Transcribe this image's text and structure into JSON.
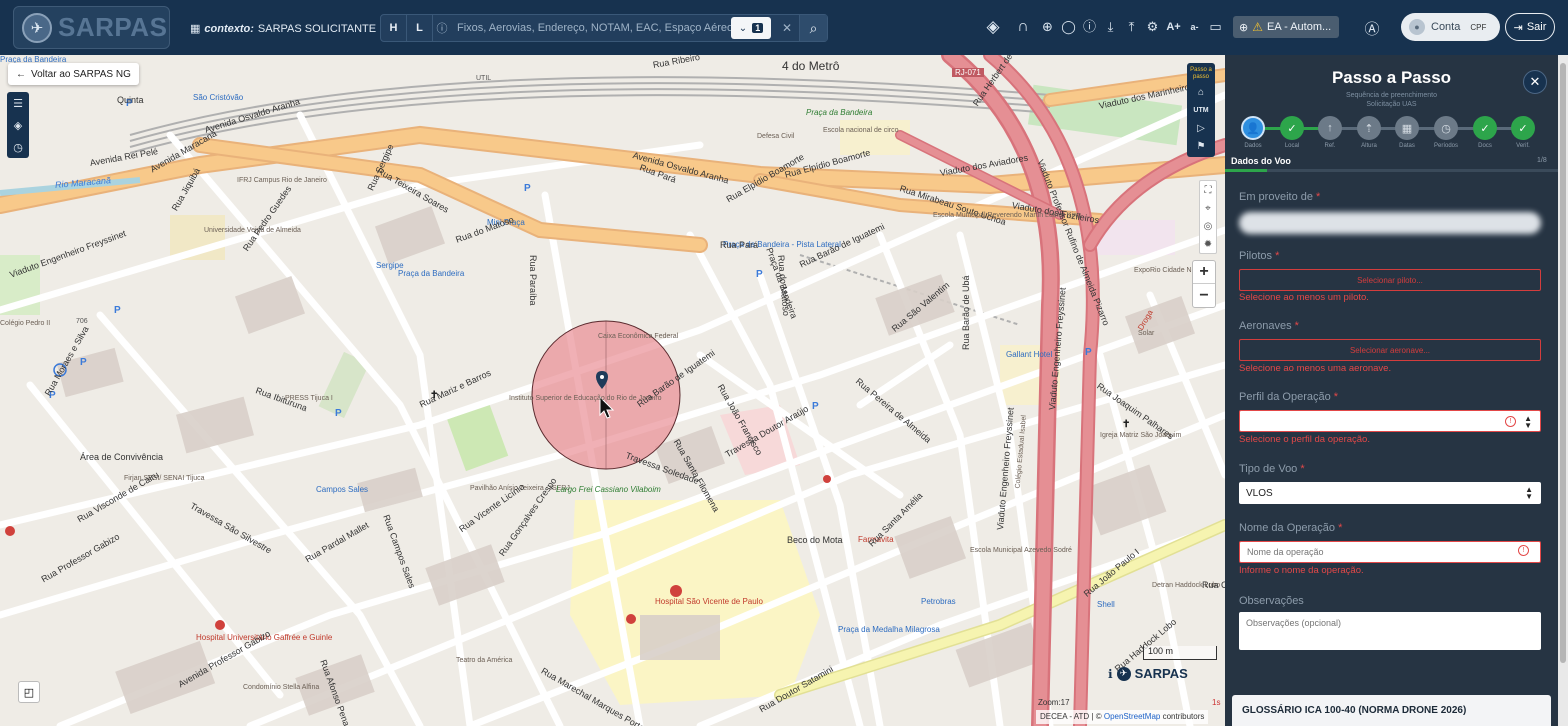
{
  "header": {
    "logo_text": "SARPAS",
    "context_label": "contexto:",
    "context_value": "SARPAS SOLICITANTE",
    "search": {
      "h_label": "H",
      "l_label": "L",
      "placeholder": "Fixos, Aerovias, Endereço, NOTAM, EAC, Espaço Aéreo (",
      "filter_count": "1"
    },
    "env_label": "EA - Autom...",
    "account_label": "Conta",
    "account_cpf": "CPF",
    "logout_label": "Sair"
  },
  "map": {
    "back_label": "Voltar ao SARPAS NG",
    "passo_label": "Passo a passo",
    "utm_label": "UTM",
    "zoom_in": "+",
    "zoom_out": "−",
    "scale_label": "100 m",
    "zoom_label": "Zoom:17",
    "attribution_prefix": "DECEA - ATD | ©",
    "attribution_link": "OpenStreetMap",
    "attribution_suffix": "contributors",
    "brand": "SARPAS",
    "timestamp": "1s",
    "labels": [
      {
        "text": "4 do Metrô",
        "cls": "lbl-lg"
      },
      {
        "text": "São Cristóvão",
        "cls": "lbl-blue"
      },
      {
        "text": "Quinta",
        "cls": "lbl"
      },
      {
        "text": "UTIL",
        "cls": "lbl-sm"
      },
      {
        "text": "Rua Ribeiro",
        "cls": "lbl"
      },
      {
        "text": "Avenida Osvaldo Aranha",
        "cls": "lbl"
      },
      {
        "text": "Avenida Rei Pelé",
        "cls": "lbl"
      },
      {
        "text": "Rio Maracanã",
        "cls": "lbl-water"
      },
      {
        "text": "Avenida Maracanã",
        "cls": "lbl"
      },
      {
        "text": "Rua Teixeira Soares",
        "cls": "lbl"
      },
      {
        "text": "Avenida Osvaldo Aranha",
        "cls": "lbl"
      },
      {
        "text": "Rua Pará",
        "cls": "lbl"
      },
      {
        "text": "Rua Elpídio Boamorte",
        "cls": "lbl"
      },
      {
        "text": "Praça da Bandeira",
        "cls": "lbl-green"
      },
      {
        "text": "Escola nacional de circo",
        "cls": "lbl-gray"
      },
      {
        "text": "Defesa Civil",
        "cls": "lbl-gray"
      },
      {
        "text": "Viaduto dos Marinheiros",
        "cls": "lbl"
      },
      {
        "text": "Viaduto dos Aviadores",
        "cls": "lbl"
      },
      {
        "text": "Rua Mirabeau Souto Uchoa",
        "cls": "lbl"
      },
      {
        "text": "Viaduto dos Fuzileiros",
        "cls": "lbl"
      },
      {
        "text": "RJ-071",
        "cls": "lbl-shield"
      },
      {
        "text": "IFRJ Campus Rio de Janeiro",
        "cls": "lbl-gray"
      },
      {
        "text": "Universidade Veiga de Almeida",
        "cls": "lbl-gray"
      },
      {
        "text": "Mini Praça",
        "cls": "lbl-blue"
      },
      {
        "text": "Praça da Bandeira - Pista Lateral",
        "cls": "lbl-blue"
      },
      {
        "text": "Rua Barão de Iguatemi",
        "cls": "lbl"
      },
      {
        "text": "Escola Municipal Reverendo Martin Luther King",
        "cls": "lbl-gray"
      },
      {
        "text": "ExpoRio Cidade Nova",
        "cls": "lbl-gray"
      },
      {
        "text": "Solar",
        "cls": "lbl-gray"
      },
      {
        "text": "Gallant Hotel",
        "cls": "lbl-blue"
      },
      {
        "text": "Rua São Valentim",
        "cls": "lbl"
      },
      {
        "text": "Rua Pereira de Almeida",
        "cls": "lbl"
      },
      {
        "text": "Rua Joaquim Palhares",
        "cls": "lbl"
      },
      {
        "text": "Igreja Matriz São Joaquim",
        "cls": "lbl-gray"
      },
      {
        "text": "Caixa Econômica Federal",
        "cls": "lbl-gray"
      },
      {
        "text": "Instituto Superior de Educação do Rio de Janeiro",
        "cls": "lbl-gray"
      },
      {
        "text": "Rua Mariz e Barros",
        "cls": "lbl"
      },
      {
        "text": "Rua Barão de Iguatemi",
        "cls": "lbl"
      },
      {
        "text": "Rua João Francisco",
        "cls": "lbl"
      },
      {
        "text": "Travessa Soledade",
        "cls": "lbl"
      },
      {
        "text": "Rua Santa Filomena",
        "cls": "lbl"
      },
      {
        "text": "Travessa Doutor Araújo",
        "cls": "lbl"
      },
      {
        "text": "Rua do Matoso",
        "cls": "lbl"
      },
      {
        "text": "Beco do Mota",
        "cls": "lbl"
      },
      {
        "text": "Farmavita",
        "cls": "lbl-red"
      },
      {
        "text": "Área de Convivência",
        "cls": "lbl"
      },
      {
        "text": "Firjan SESI/ SENAI Tijuca",
        "cls": "lbl-gray"
      },
      {
        "text": "Travessa São Silvestre",
        "cls": "lbl"
      },
      {
        "text": "Campos Sales",
        "cls": "lbl-blue"
      },
      {
        "text": "Pavilhão Anísio Teixeira - ISERJ",
        "cls": "lbl-gray"
      },
      {
        "text": "Largo Frei Cassiano Vilaboim",
        "cls": "lbl-green"
      },
      {
        "text": "Hospital São Vicente de Paulo",
        "cls": "lbl-red"
      },
      {
        "text": "Hospital Universitário Gaffrée e Guinle",
        "cls": "lbl-red"
      },
      {
        "text": "Teatro da América",
        "cls": "lbl-gray"
      },
      {
        "text": "Condomínio Stella Alfina",
        "cls": "lbl-gray"
      },
      {
        "text": "Rua Marechal Marques Porto",
        "cls": "lbl"
      },
      {
        "text": "Rua Vicente Licínio",
        "cls": "lbl"
      },
      {
        "text": "Rua Gonçalves Crespo",
        "cls": "lbl"
      },
      {
        "text": "Rua Pardal Mallet",
        "cls": "lbl"
      },
      {
        "text": "Rua Campos Sales",
        "cls": "lbl"
      },
      {
        "text": "Rua Afonso Pena",
        "cls": "lbl"
      },
      {
        "text": "Rua Professor Gabizo",
        "cls": "lbl"
      },
      {
        "text": "Avenida Professor Gabizo",
        "cls": "lbl"
      },
      {
        "text": "Rua Visconde de Cairu",
        "cls": "lbl"
      },
      {
        "text": "Rua Ibituruna",
        "cls": "lbl"
      },
      {
        "text": "Rua Pedro Guedes",
        "cls": "lbl"
      },
      {
        "text": "Rua Moraes e Silva",
        "cls": "lbl"
      },
      {
        "text": "Rua Sergipe",
        "cls": "lbl"
      },
      {
        "text": "Rua Jiquibá",
        "cls": "lbl"
      },
      {
        "text": "Rua Paraíba",
        "cls": "lbl"
      },
      {
        "text": "Petrobras",
        "cls": "lbl-blue"
      },
      {
        "text": "Praça da Medalha Milagrosa",
        "cls": "lbl-blue"
      },
      {
        "text": "Escola Municipal Azevedo Sodré",
        "cls": "lbl-gray"
      },
      {
        "text": "Rua Santa Amélia",
        "cls": "lbl"
      },
      {
        "text": "Rua João Paulo I",
        "cls": "lbl"
      },
      {
        "text": "Detran Haddock Lobo",
        "cls": "lbl-gray"
      },
      {
        "text": "Shell",
        "cls": "lbl-blue"
      },
      {
        "text": "Rua Haddock Lobo",
        "cls": "lbl"
      },
      {
        "text": "Rua Doutor Satamini",
        "cls": "lbl"
      },
      {
        "text": "Viaduto Engenheiro Freyssinet",
        "cls": "lbl"
      },
      {
        "text": "Viaduto Professor Rufino de Almeida Pizarro",
        "cls": "lbl"
      },
      {
        "text": "Viaduto Engenheiro Freyssinet",
        "cls": "lbl"
      },
      {
        "text": "Rua Barão de Ubá",
        "cls": "lbl"
      },
      {
        "text": "Praça da Bandeira",
        "cls": "lbl-blue"
      },
      {
        "text": "Sergipe",
        "cls": "lbl-blue"
      },
      {
        "text": "Colégio Pedro II",
        "cls": "lbl-gray"
      },
      {
        "text": "706",
        "cls": "lbl-sm"
      },
      {
        "text": "PRESS Tijuca I",
        "cls": "lbl-gray"
      },
      {
        "text": "Colégio Estadual Isabel",
        "cls": "lbl-gray"
      },
      {
        "text": "Viaduto Engenheiro Freyssinet",
        "cls": "lbl"
      },
      {
        "text": "Rua Canabarro",
        "cls": "lbl"
      },
      {
        "text": "Droga",
        "cls": "lbl-red"
      },
      {
        "text": "Rua Herbert de Souza",
        "cls": "lbl"
      },
      {
        "text": "Rua Elpídio Boamorte",
        "cls": "lbl"
      },
      {
        "text": "Praça da Bandeira",
        "cls": "lbl"
      },
      {
        "text": "Rua do Matoso",
        "cls": "lbl"
      },
      {
        "text": "Rua Pará",
        "cls": "lbl"
      },
      {
        "text": "Praça da Bandeira",
        "cls": "lbl-blue"
      }
    ]
  },
  "panel": {
    "title": "Passo a Passo",
    "subtitle_1": "Sequência de preenchimento",
    "subtitle_2": "Solicitação UAS",
    "steps": [
      {
        "label": "Dados",
        "state": "active",
        "glyph": "👤"
      },
      {
        "label": "Local",
        "state": "done",
        "glyph": "✓"
      },
      {
        "label": "Ref.",
        "state": "todo",
        "glyph": "↑"
      },
      {
        "label": "Altura",
        "state": "todo",
        "glyph": "⇡"
      },
      {
        "label": "Datas",
        "state": "todo",
        "glyph": "▦"
      },
      {
        "label": "Períodos",
        "state": "todo",
        "glyph": "◷"
      },
      {
        "label": "Docs",
        "state": "done",
        "glyph": "✓"
      },
      {
        "label": "Verif.",
        "state": "done",
        "glyph": "✓"
      }
    ],
    "progress_fraction": 0.125,
    "section_title": "Dados do Voo",
    "section_count": "1/8",
    "fields": {
      "em_proveito_label": "Em proveito de",
      "pilotos_label": "Pilotos",
      "pilotos_btn": "Selecionar piloto...",
      "pilotos_err": "Selecione ao menos um piloto.",
      "aeronaves_label": "Aeronaves",
      "aeronaves_btn": "Selecionar aeronave...",
      "aeronaves_err": "Selecione ao menos uma aeronave.",
      "perfil_label": "Perfil da Operação",
      "perfil_value": "",
      "perfil_err": "Selecione o perfil da operação.",
      "tipo_label": "Tipo de Voo",
      "tipo_value": "VLOS",
      "nome_label": "Nome da Operação",
      "nome_placeholder": "Nome da operação",
      "nome_err": "Informe o nome da operação.",
      "obs_label": "Observações",
      "obs_placeholder": "Observações (opcional)"
    },
    "required_mark": "*",
    "glossary": "GLOSSÁRIO ICA 100-40 (NORMA DRONE 2026)"
  },
  "colors": {
    "topbar": "#17324f",
    "panel": "#263443",
    "error": "#e34848",
    "success": "#2da54b",
    "active_step": "#2e8fe0",
    "road_primary": "#f8c98a",
    "road_trunk": "#e58f94",
    "operation_area": "#e8868d"
  }
}
